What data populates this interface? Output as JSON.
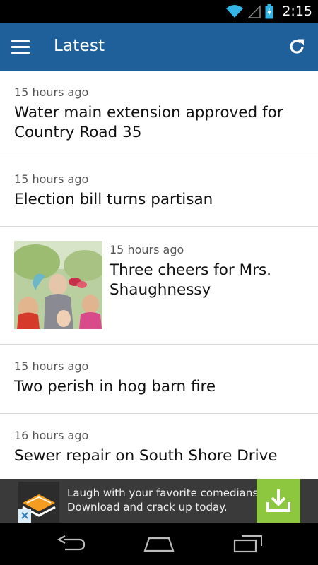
{
  "status_bar": {
    "time": "2:15",
    "icons": [
      "wifi-icon",
      "signal-icon",
      "battery-icon"
    ]
  },
  "app_bar": {
    "title": "Latest",
    "menu_icon": "menu-icon",
    "refresh_icon": "refresh-icon",
    "background_color": "#1f5f9a"
  },
  "feed": {
    "items": [
      {
        "time": "15 hours ago",
        "headline": "Water main extension approved for Country Road 35"
      },
      {
        "time": "15 hours ago",
        "headline": "Election bill turns partisan"
      },
      {
        "time": "15 hours ago",
        "headline": "Three cheers for Mrs. Shaughnessy"
      },
      {
        "time": "15 hours ago",
        "headline": "Two perish in hog barn fire"
      },
      {
        "time": "16 hours ago",
        "headline": "Sewer repair on South Shore Drive"
      }
    ]
  },
  "ad": {
    "line1": "Laugh with your favorite comedians",
    "line2": "Download and crack up today.",
    "download_icon": "download-icon",
    "close_icon": "close-icon",
    "accent_color": "#8dc63f"
  },
  "nav_bar": {
    "buttons": [
      "back-icon",
      "home-icon",
      "recent-apps-icon"
    ]
  }
}
